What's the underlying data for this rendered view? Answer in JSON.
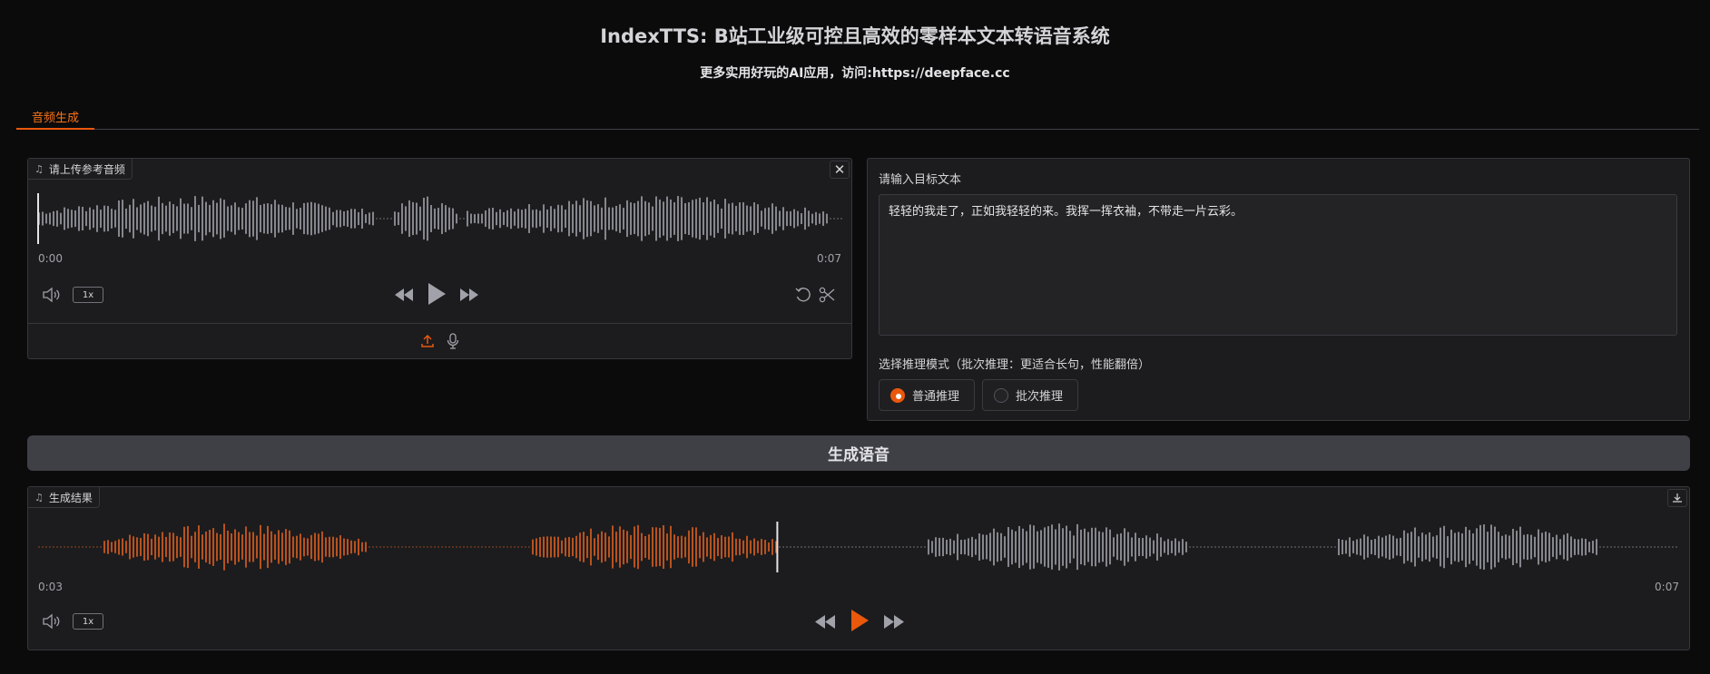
{
  "header": {
    "title": "IndexTTS: B站工业级可控且高效的零样本文本转语音系统",
    "subtitle": "更多实用好玩的AI应用，访问:https://deepface.cc"
  },
  "tabs": [
    {
      "label": "音频生成",
      "active": true
    }
  ],
  "reference_audio": {
    "label": "请上传参考音频",
    "time_current": "0:00",
    "time_total": "0:07",
    "playback_rate": "1x",
    "progress": 0
  },
  "target_text": {
    "label": "请输入目标文本",
    "value": "轻轻的我走了，正如我轻轻的来。我挥一挥衣袖，不带走一片云彩。"
  },
  "mode": {
    "label": "选择推理模式（批次推理：更适合长句，性能翻倍）",
    "options": [
      {
        "label": "普通推理",
        "selected": true
      },
      {
        "label": "批次推理",
        "selected": false
      }
    ]
  },
  "generate_button": {
    "label": "生成语音"
  },
  "result_audio": {
    "label": "生成结果",
    "time_current": "0:03",
    "time_total": "0:07",
    "playback_rate": "1x",
    "progress": 0.45
  },
  "colors": {
    "accent": "#ea580c",
    "wave_idle": "#a1a1aa",
    "wave_played": "#e0601e"
  }
}
